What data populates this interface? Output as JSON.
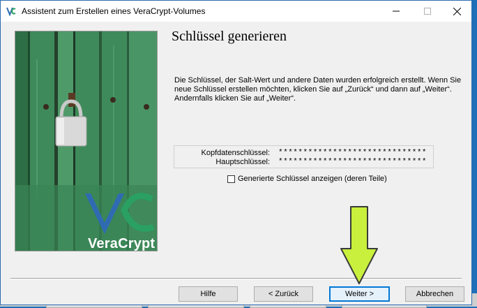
{
  "window": {
    "title": "Assistent zum Erstellen eines VeraCrypt-Volumes",
    "icon_text": "VC"
  },
  "side_image": {
    "brand": "VeraCrypt",
    "colors": {
      "board_green": "#3f8a5b",
      "logo_blue": "#2f6bb3",
      "logo_green": "#2aa063"
    }
  },
  "page": {
    "heading": "Schlüssel generieren",
    "info": "Die Schlüssel, der Salt-Wert und andere Daten wurden erfolgreich erstellt. Wenn Sie neue Schlüssel erstellen möchten, klicken Sie auf „Zurück“ und dann auf „Weiter“. Andernfalls klicken Sie auf „Weiter“."
  },
  "keys": [
    {
      "label": "Kopfdatenschlüssel:",
      "value": "******************************"
    },
    {
      "label": "Hauptschlüssel:",
      "value": "******************************"
    }
  ],
  "show_keys_checkbox": {
    "label": "Generierte Schlüssel anzeigen (deren Teile)",
    "checked": false
  },
  "buttons": {
    "help": "Hilfe",
    "back": "< Zurück",
    "next": "Weiter >",
    "cancel": "Abbrechen"
  },
  "annotation": {
    "arrow_color": "#c8f03c"
  }
}
